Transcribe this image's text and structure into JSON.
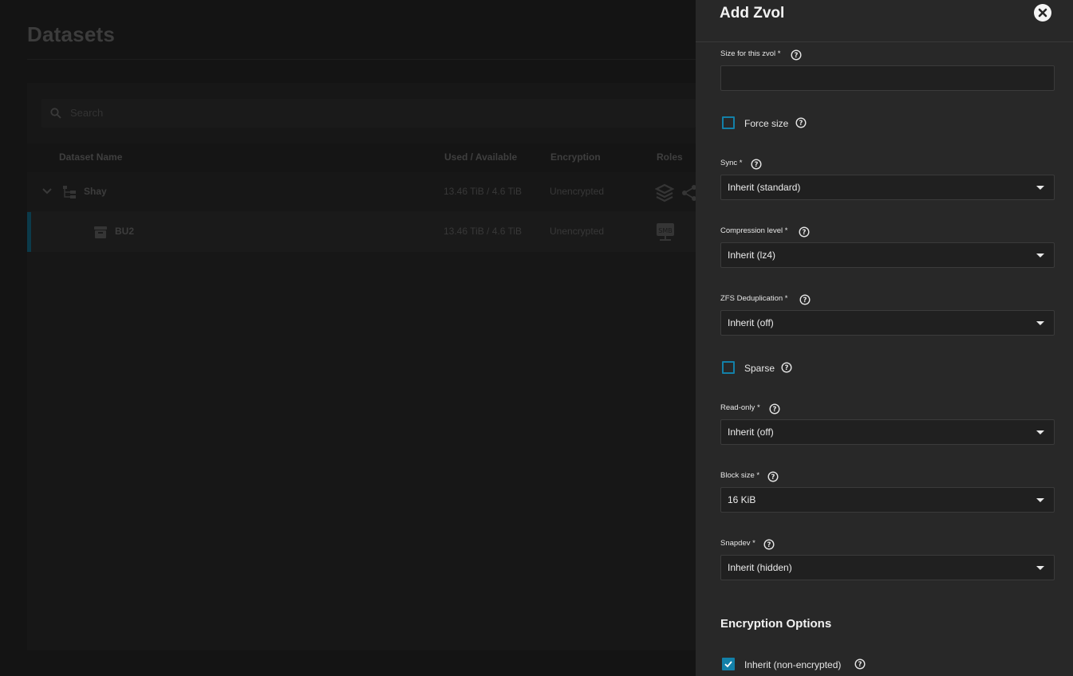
{
  "background": {
    "page_title": "Datasets",
    "search": {
      "placeholder": "Search"
    },
    "columns": {
      "name": "Dataset Name",
      "used": "Used / Available",
      "encryption": "Encryption",
      "roles": "Roles"
    },
    "rows": [
      {
        "name": "Shay",
        "used": "13.46 TiB / 4.6 TiB",
        "encryption": "Unencrypted"
      },
      {
        "name": "BU2",
        "used": "13.46 TiB / 4.6 TiB",
        "encryption": "Unencrypted"
      }
    ]
  },
  "panel": {
    "title": "Add Zvol",
    "size": {
      "label": "Size for this zvol *",
      "value": ""
    },
    "force_size": {
      "label": "Force size",
      "checked": false
    },
    "sync": {
      "label": "Sync *",
      "value": "Inherit (standard)"
    },
    "compression": {
      "label": "Compression level *",
      "value": "Inherit (lz4)"
    },
    "dedup": {
      "label": "ZFS Deduplication *",
      "value": "Inherit (off)"
    },
    "sparse": {
      "label": "Sparse",
      "checked": false
    },
    "readonly": {
      "label": "Read-only *",
      "value": "Inherit (off)"
    },
    "blocksize": {
      "label": "Block size *",
      "value": "16 KiB"
    },
    "snapdev": {
      "label": "Snapdev *",
      "value": "Inherit (hidden)"
    },
    "encryption_section": "Encryption Options",
    "inherit_encryption": {
      "label": "Inherit (non-encrypted)",
      "checked": true
    }
  },
  "colors": {
    "accent": "#1380a8",
    "panel_bg": "#282828",
    "field_bg": "#202020"
  }
}
